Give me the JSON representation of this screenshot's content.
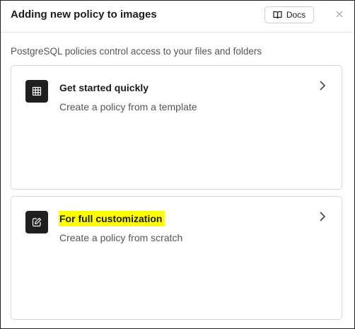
{
  "dialog": {
    "title": "Adding new policy to images",
    "docs_label": "Docs",
    "subtitle": "PostgreSQL policies control access to your files and folders"
  },
  "cards": [
    {
      "icon": "grid-icon",
      "title": "Get started quickly",
      "description": "Create a policy from a template"
    },
    {
      "icon": "edit-icon",
      "title": "For full customization",
      "description": "Create a policy from scratch",
      "highlight_color": "#ffff00"
    }
  ]
}
